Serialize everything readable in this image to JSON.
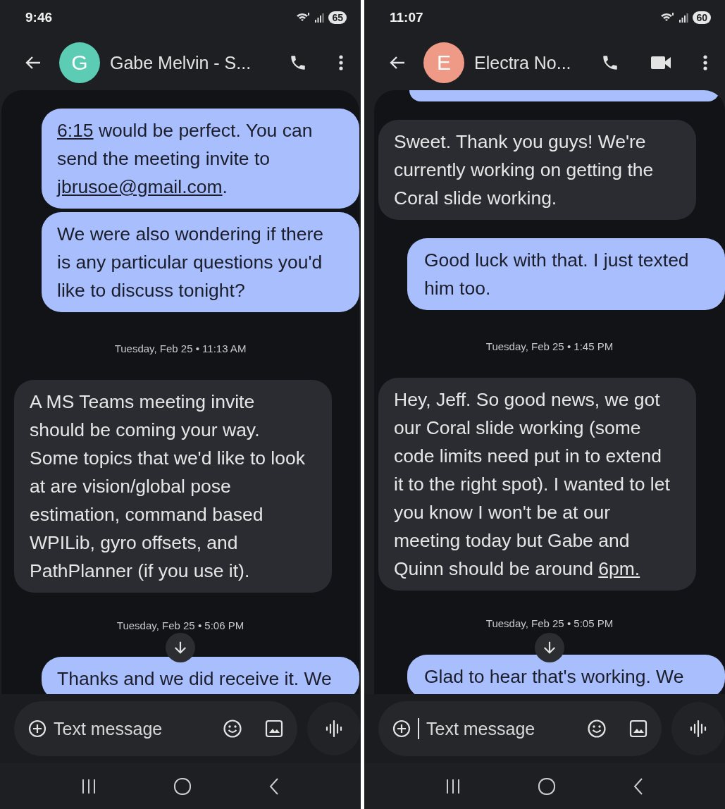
{
  "phones": [
    {
      "status_bar": {
        "time": "9:46",
        "battery": "65"
      },
      "header": {
        "avatar_letter": "G",
        "color": "#5ccdb4",
        "name": "Gabe Melvin - S...",
        "actions": [
          {
            "kind": "call"
          },
          {
            "kind": "more"
          }
        ]
      },
      "messages": [
        {
          "kind": "sent",
          "segments": [
            {
              "text": "6:15",
              "link": true
            },
            {
              "text": " would be perfect. You can send the meeting invite to ",
              "link": false
            },
            {
              "text": "jbrusoe@gmail.com",
              "link": true
            },
            {
              "text": ".",
              "link": false
            }
          ]
        },
        {
          "kind": "sent",
          "segments": [
            {
              "text": "We were also wondering if there is any particular questions you'd like to discuss tonight?",
              "link": false
            }
          ]
        },
        {
          "kind": "timestamp",
          "text": "Tuesday, Feb 25 • 11:13 AM"
        },
        {
          "kind": "received",
          "segments": [
            {
              "text": "A MS Teams meeting invite should be coming your way. Some topics that we'd like to look at are vision/global pose estimation, command based WPILib, gyro offsets, and PathPlanner (if you use it).",
              "link": false
            }
          ]
        },
        {
          "kind": "timestamp",
          "text": "Tuesday, Feb 25 • 5:06 PM"
        },
        {
          "kind": "sent",
          "segments": [
            {
              "text": "Thanks and we did receive it. We",
              "link": false
            }
          ]
        }
      ],
      "composer": {
        "placeholder": "Text message",
        "focused": false
      }
    },
    {
      "status_bar": {
        "time": "11:07",
        "battery": "60"
      },
      "header": {
        "avatar_letter": "E",
        "color": "#ef9a86",
        "name": "Electra No...",
        "actions": [
          {
            "kind": "call"
          },
          {
            "kind": "video"
          },
          {
            "kind": "more"
          }
        ]
      },
      "messages": [
        {
          "kind": "sent_edge"
        },
        {
          "kind": "received",
          "segments": [
            {
              "text": "Sweet. Thank you guys! We're currently working on getting the Coral slide working.",
              "link": false
            }
          ]
        },
        {
          "kind": "sent",
          "segments": [
            {
              "text": "Good luck with that. I just texted him too.",
              "link": false
            }
          ]
        },
        {
          "kind": "timestamp",
          "text": "Tuesday, Feb 25 • 1:45 PM"
        },
        {
          "kind": "received",
          "segments": [
            {
              "text": "Hey, Jeff. So good news, we got our Coral slide working (some code limits need put in to extend it to the right spot). I wanted to let you know I won't be at our meeting today but Gabe and Quinn should be around ",
              "link": false
            },
            {
              "text": "6pm.",
              "link": true
            }
          ]
        },
        {
          "kind": "timestamp",
          "text": "Tuesday, Feb 25 • 5:05 PM"
        },
        {
          "kind": "sent",
          "segments": [
            {
              "text": "Glad to hear that's working. We",
              "link": false
            }
          ]
        }
      ],
      "composer": {
        "placeholder": "Text message",
        "focused": true
      }
    }
  ]
}
